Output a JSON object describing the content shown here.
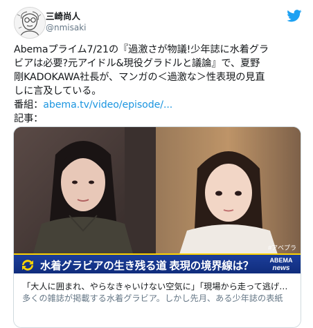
{
  "author": {
    "name": "三崎尚人",
    "handle": "@nmisaki",
    "avatar_icon": "sketch-portrait-avatar"
  },
  "brand_icon": "twitter-bird-icon",
  "tweet": {
    "line1": "Abemaプライム7/21の『過激さが物議!少年誌に水着グラ",
    "line2": "ビアは必要?元アイドル&現役グラドルと議論』で、夏野",
    "line3": "剛KADOKAWA社長が、マンガの＜過激な＞性表現の見直",
    "line4": "しに言及している。",
    "program_label": "番組：",
    "program_link": "abema.tv/video/episode/...",
    "article_label": "記事："
  },
  "card": {
    "banner_text": "水着グラビアの生き残る道 表現の境界線は？",
    "banner_logo_top": "ABEMA",
    "banner_logo_bottom": "news",
    "watermark": "#アベプラ",
    "title": "「大人に囲まれ、やらなきゃいけない空気に」「現場から走って逃げ…",
    "description": "多くの雑誌が掲載する水着グラビア。しかし先月、ある少年誌の表紙"
  },
  "colors": {
    "link": "#1b95e0",
    "twitter_blue": "#1da1f2",
    "banner": "#1c3e9a",
    "banner_border": "#ffd400"
  }
}
